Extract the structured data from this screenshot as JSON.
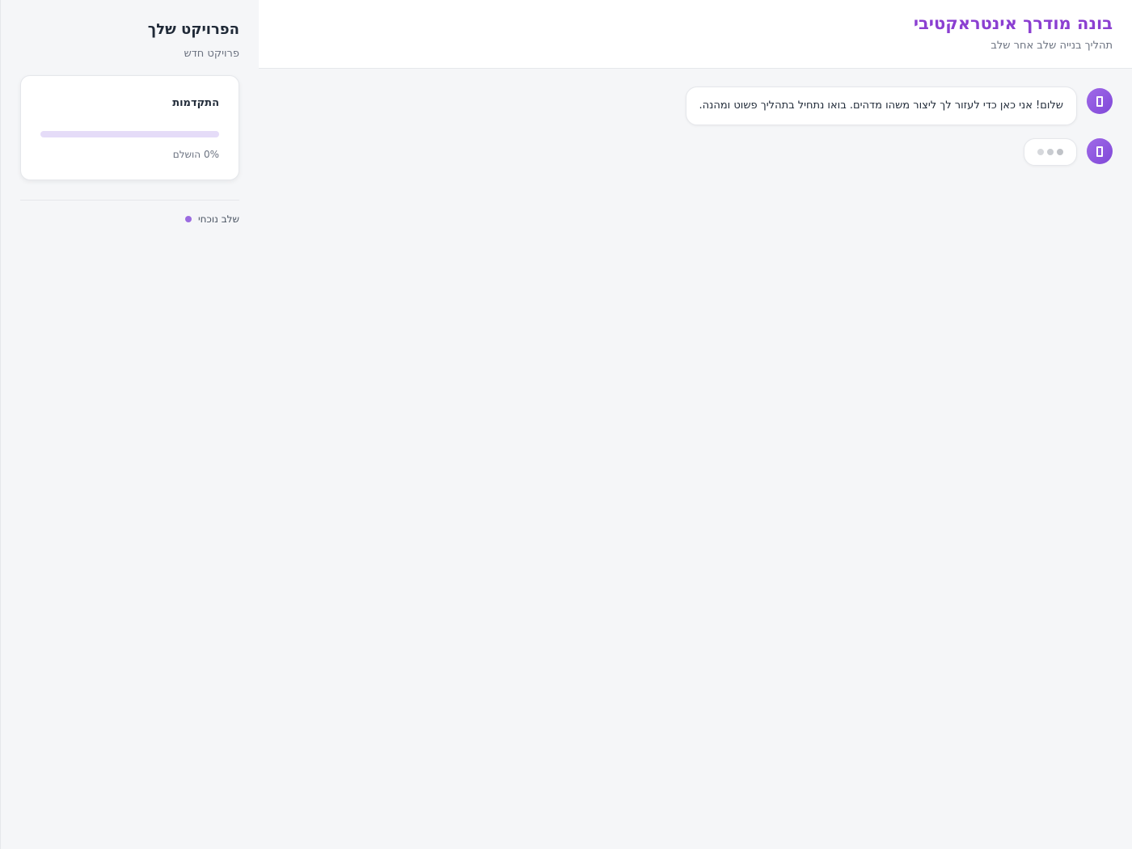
{
  "sidebar": {
    "title": "הפרויקט שלך",
    "subtitle": "פרויקט חדש",
    "progress": {
      "label": "התקדמות",
      "percent": 0,
      "text": "0% הושלם"
    },
    "current_step_label": "שלב נוכחי"
  },
  "header": {
    "title": "בונה מודרך אינטראקטיבי",
    "subtitle": "תהליך בנייה שלב אחר שלב"
  },
  "messages": [
    {
      "sender": "assistant",
      "text": "שלום! אני כאן כדי לעזור לך ליצור משהו מדהים. בואו נתחיל בתהליך פשוט ומהנה."
    }
  ],
  "colors": {
    "accent": "#8b3fd1",
    "avatar": "#8b5cf6",
    "progress_track": "#e5dcf8",
    "step_dot": "#9b6be0"
  },
  "icons": {
    "avatar": "bot-icon",
    "typing": "typing-indicator"
  }
}
